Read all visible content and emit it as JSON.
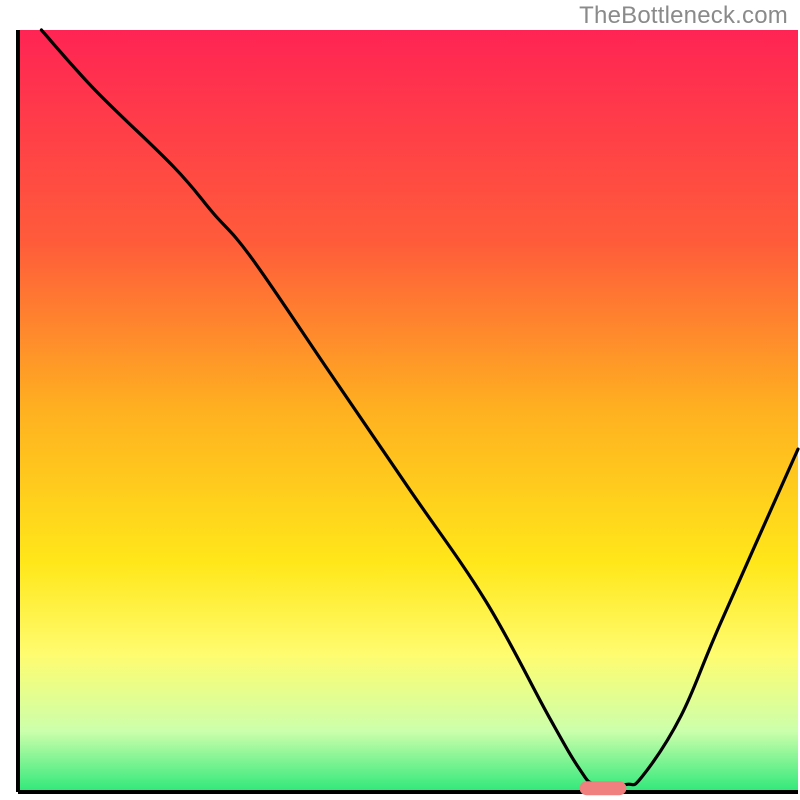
{
  "watermark": "TheBottleneck.com",
  "chart_data": {
    "type": "line",
    "title": "",
    "xlabel": "",
    "ylabel": "",
    "xlim": [
      0,
      100
    ],
    "ylim": [
      0,
      100
    ],
    "x": [
      3,
      10,
      20,
      25,
      30,
      40,
      50,
      60,
      68,
      72,
      74,
      78,
      80,
      85,
      90,
      100
    ],
    "values": [
      100,
      92,
      82,
      76,
      70,
      55,
      40,
      25,
      10,
      3,
      1,
      1,
      2,
      10,
      22,
      45
    ],
    "marker": {
      "x_start": 72,
      "x_end": 78,
      "y": 0.5,
      "color": "#f08080"
    },
    "background_gradient": {
      "stops": [
        {
          "offset": 0,
          "color": "#ff2454"
        },
        {
          "offset": 0.28,
          "color": "#ff5c3a"
        },
        {
          "offset": 0.5,
          "color": "#ffb120"
        },
        {
          "offset": 0.7,
          "color": "#ffe71a"
        },
        {
          "offset": 0.82,
          "color": "#fffc70"
        },
        {
          "offset": 0.92,
          "color": "#ccffab"
        },
        {
          "offset": 1.0,
          "color": "#2ee87a"
        }
      ]
    },
    "axis_color": "#000000",
    "line_color": "#000000"
  }
}
